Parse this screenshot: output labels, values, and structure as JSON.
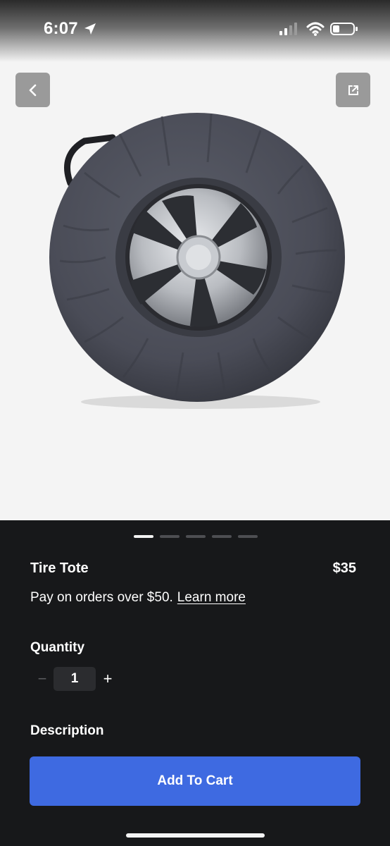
{
  "status": {
    "time": "6:07"
  },
  "icons": {
    "back": "chevron-left-icon",
    "share": "external-link-icon",
    "location": "location-arrow-icon",
    "signal": "cellular-signal-icon",
    "wifi": "wifi-icon",
    "battery": "battery-icon"
  },
  "carousel": {
    "total": 5,
    "active_index": 0
  },
  "product": {
    "name": "Tire Tote",
    "price": "$35",
    "pay_text": "Pay on orders over $50.",
    "learn_more": "Learn more"
  },
  "quantity": {
    "label": "Quantity",
    "value": "1",
    "minus": "−",
    "plus": "+"
  },
  "description": {
    "label": "Description"
  },
  "cart": {
    "button_label": "Add To Cart"
  },
  "colors": {
    "accent": "#3e6ae1",
    "panel_bg": "#17181a",
    "image_bg": "#f4f4f4"
  }
}
